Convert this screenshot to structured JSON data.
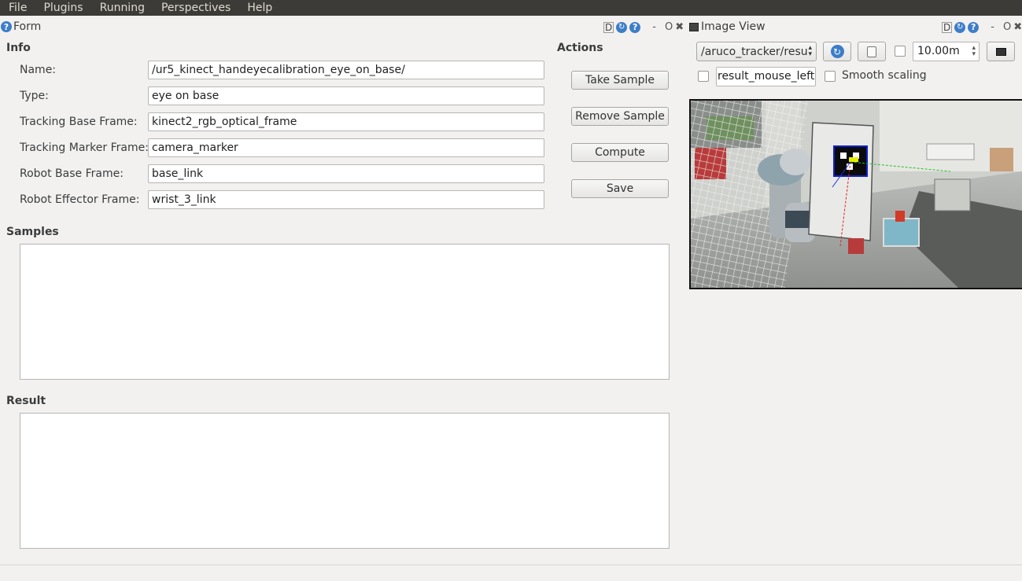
{
  "menubar": {
    "items": [
      "File",
      "Plugins",
      "Running",
      "Perspectives",
      "Help"
    ]
  },
  "form_dock": {
    "title": "Form",
    "help": "?",
    "ctrl_d": "D",
    "ctrl_dash": "-",
    "ctrl_o": "O",
    "ctrl_x": "✖",
    "info_label": "Info",
    "actions_label": "Actions",
    "fields": [
      {
        "label": "Name:",
        "value": "/ur5_kinect_handeyecalibration_eye_on_base/"
      },
      {
        "label": "Type:",
        "value": "eye on base"
      },
      {
        "label": "Tracking Base Frame:",
        "value": "kinect2_rgb_optical_frame"
      },
      {
        "label": "Tracking Marker Frame:",
        "value": "camera_marker"
      },
      {
        "label": "Robot Base Frame:",
        "value": "base_link"
      },
      {
        "label": "Robot Effector Frame:",
        "value": "wrist_3_link"
      }
    ],
    "buttons": [
      "Take Sample",
      "Remove Sample",
      "Compute",
      "Save"
    ],
    "samples_label": "Samples",
    "result_label": "Result"
  },
  "image_dock": {
    "title": "Image View",
    "help": "?",
    "ctrl_d": "D",
    "ctrl_dash": "-",
    "ctrl_o": "O",
    "ctrl_x": "✖",
    "topic": "/aruco_tracker/resu",
    "refresh": "↻",
    "max_depth": "10.00m",
    "mouse_topic": "result_mouse_left",
    "smooth_label": "Smooth scaling"
  },
  "colors": {
    "menubar": "#3c3b37",
    "accent": "#3d7dc8",
    "marker_box": "#1020d0"
  }
}
